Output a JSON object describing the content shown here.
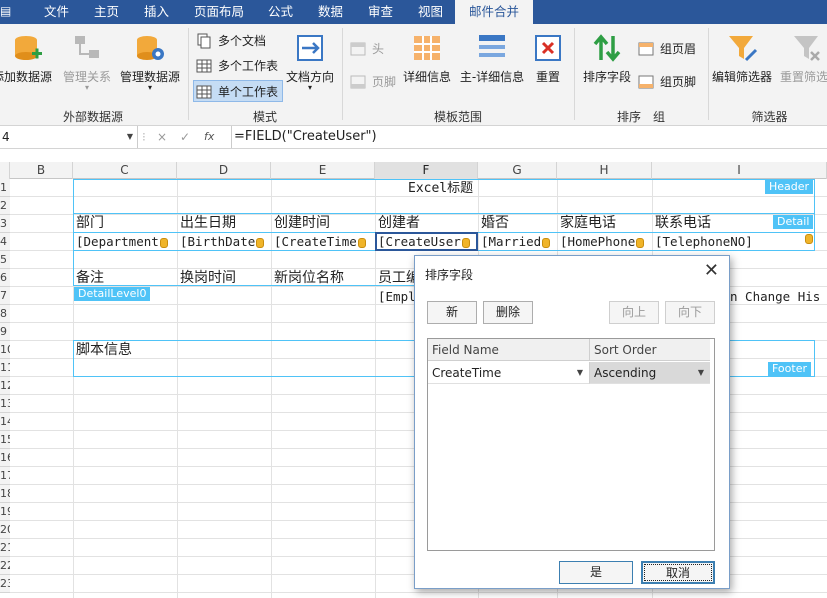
{
  "menu": {
    "tabs": [
      "文件",
      "主页",
      "插入",
      "页面布局",
      "公式",
      "数据",
      "审查",
      "视图",
      "邮件合并"
    ],
    "active": "邮件合并"
  },
  "ribbon": {
    "add_datasource": "添加数据源",
    "manage_relations": "管理关系",
    "manage_datasource": "管理数据源",
    "group_external": "外部数据源",
    "multi_doc": "多个文档",
    "multi_sheet": "多个工作表",
    "single_sheet": "单个工作表",
    "doc_direction": "文档方向",
    "group_mode": "模式",
    "header": "头",
    "footer": "页脚",
    "detail": "详细信息",
    "master_detail": "主-详细信息",
    "reset": "重置",
    "group_template": "模板范围",
    "sort_field": "排序字段",
    "group_header": "组页眉",
    "group_footer": "组页脚",
    "group_sort": "排序　组",
    "edit_filter": "编辑筛选器",
    "reset_filter": "重置筛选",
    "group_filter": "筛选器"
  },
  "formula_bar": {
    "name_box": "4",
    "cancel_glyph": "×",
    "enter_glyph": "✓",
    "fx_glyph": "fx",
    "formula": "=FIELD(\"CreateUser\")"
  },
  "sheet": {
    "columns": [
      "B",
      "C",
      "D",
      "E",
      "F",
      "G",
      "H",
      "I"
    ],
    "rows": [
      "1",
      "2",
      "3",
      "4",
      "5",
      "6",
      "7",
      "8",
      "9",
      "10",
      "11",
      "12",
      "13",
      "14",
      "15",
      "16",
      "17",
      "18",
      "19",
      "20",
      "21",
      "22",
      "23"
    ],
    "title": "Excel标题",
    "tags": {
      "header": "Header",
      "detail": "Detail",
      "detail_level0": "DetailLevel0",
      "footer": "Footer"
    },
    "row3": [
      "部门",
      "出生日期",
      "创建时间",
      "创建者",
      "婚否",
      "家庭电话",
      "联系电话"
    ],
    "row4": [
      "[Department",
      "[BirthDate",
      "[CreateTime",
      "[CreateUser",
      "[Married",
      "[HomePhone",
      "[TelephoneNO]"
    ],
    "row6": [
      "备注",
      "换岗时间",
      "新岗位名称",
      "员工编"
    ],
    "row7_f": "[Empl",
    "row7_i": "n Change His",
    "script_info": "脚本信息"
  },
  "dialog": {
    "title": "排序字段",
    "new_button": "新",
    "delete_button": "删除",
    "up_button": "向上",
    "down_button": "向下",
    "col_field": "Field Name",
    "col_order": "Sort Order",
    "row_field": "CreateTime",
    "row_order": "Ascending",
    "ok_button": "是",
    "cancel_button": "取消"
  }
}
